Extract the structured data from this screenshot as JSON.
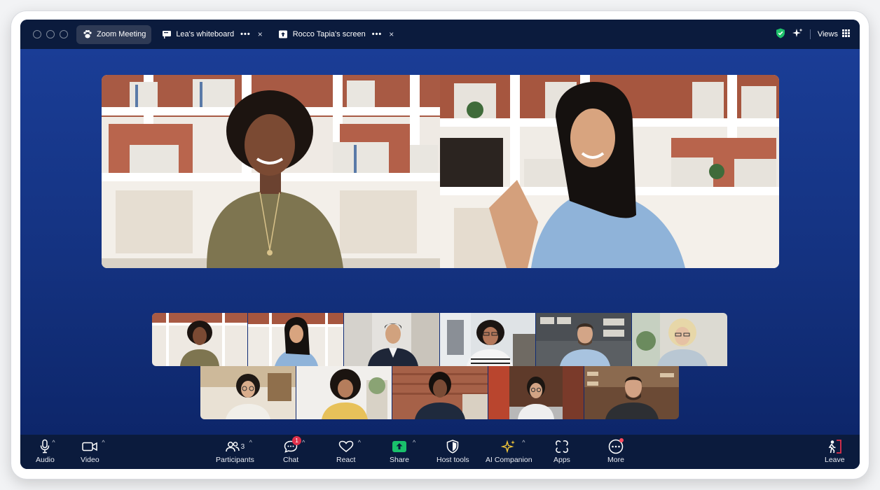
{
  "titlebar": {
    "tabs": [
      {
        "label": "Zoom Meeting",
        "icon": "paw-icon",
        "active": true
      },
      {
        "label": "Lea's whiteboard",
        "icon": "whiteboard-icon",
        "more": "•••",
        "close": "×"
      },
      {
        "label": "Rocco Tapia's screen",
        "icon": "share-screen-icon",
        "more": "•••",
        "close": "×"
      }
    ],
    "views_label": "Views"
  },
  "toolbar": {
    "audio": "Audio",
    "video": "Video",
    "participants": "Participants",
    "participants_count": "3",
    "chat": "Chat",
    "chat_badge": "1",
    "react": "React",
    "share": "Share",
    "host_tools": "Host tools",
    "ai_companion": "AI Companion",
    "apps": "Apps",
    "more": "More",
    "leave": "Leave"
  },
  "colors": {
    "stage_blue": "#143280",
    "bar_navy": "#0b1b3d",
    "share_green": "#19c06b",
    "shield_green": "#1fc16b",
    "ai_gold": "#f0c53a",
    "badge_red": "#e0314b"
  }
}
